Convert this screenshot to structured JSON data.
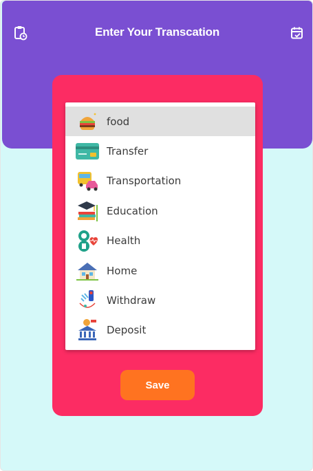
{
  "header": {
    "title": "Enter Your Transcation",
    "left_icon": "clipboard-clock-icon",
    "right_icon": "calendar-check-icon"
  },
  "dropdown": {
    "selected": "food",
    "items": [
      {
        "label": "food",
        "icon": "burger-icon"
      },
      {
        "label": "Transfer",
        "icon": "credit-card-icon"
      },
      {
        "label": "Transportation",
        "icon": "bus-car-icon"
      },
      {
        "label": "Education",
        "icon": "graduation-books-icon"
      },
      {
        "label": "Health",
        "icon": "doctor-heart-icon"
      },
      {
        "label": "Home",
        "icon": "house-icon"
      },
      {
        "label": "Withdraw",
        "icon": "withdraw-icon"
      },
      {
        "label": "Deposit",
        "icon": "bank-deposit-icon"
      }
    ]
  },
  "actions": {
    "save_label": "Save"
  },
  "colors": {
    "header": "#7a4fd2",
    "background": "#d5f9f9",
    "card": "#fc2c63",
    "save_button": "#ff7320",
    "selected_row": "#e0e0e0"
  }
}
